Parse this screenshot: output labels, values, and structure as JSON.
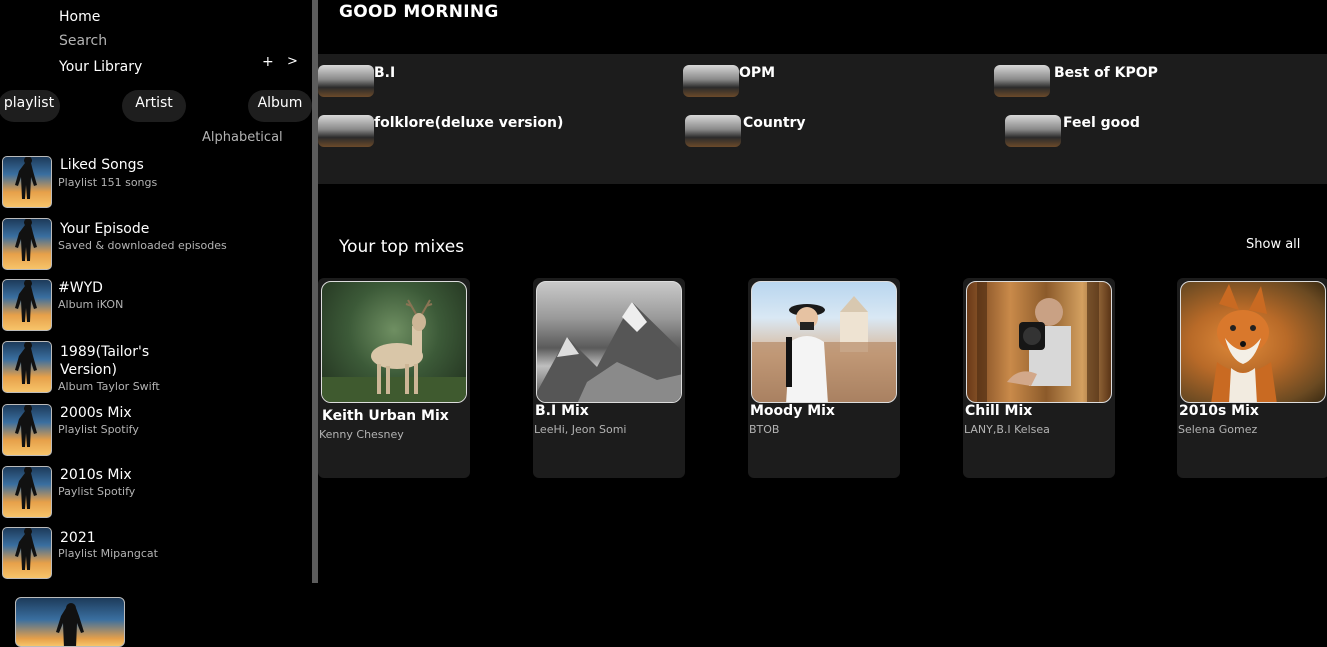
{
  "nav": {
    "home": "Home",
    "search": "Search",
    "library": "Your Library",
    "add": "+",
    "next": ">"
  },
  "filters": [
    "playlist",
    "Artist",
    "Album"
  ],
  "sort_label": "Alphabetical",
  "library_items": [
    {
      "title": "Liked Songs",
      "subtitle": "Playlist 151 songs"
    },
    {
      "title": "Your Episode",
      "subtitle": "Saved & downloaded episodes"
    },
    {
      "title": "#WYD",
      "subtitle": "Album iKON"
    },
    {
      "title": "1989(Tailor's\nVersion)",
      "subtitle": "Album Taylor Swift"
    },
    {
      "title": "2000s Mix",
      "subtitle": "Playlist Spotify"
    },
    {
      "title": "2010s Mix",
      "subtitle": "Paylist Spotify"
    },
    {
      "title": "2021",
      "subtitle": "Playlist Mipangcat"
    }
  ],
  "greeting": "GOOD MORNING",
  "quick_picks": [
    "B.I",
    "OPM",
    "Best of KPOP",
    "folklore(deluxe version)",
    "Country",
    "Feel good"
  ],
  "top_mixes": {
    "title": "Your top mixes",
    "show_all": "Show all",
    "cards": [
      {
        "title": "Keith Urban Mix",
        "subtitle": "Kenny Chesney"
      },
      {
        "title": "B.I Mix",
        "subtitle": "LeeHi, Jeon Somi"
      },
      {
        "title": "Moody Mix",
        "subtitle": "BTOB"
      },
      {
        "title": "Chill Mix",
        "subtitle": "LANY,B.I Kelsea"
      },
      {
        "title": "2010s Mix",
        "subtitle": "Selena Gomez"
      }
    ]
  }
}
